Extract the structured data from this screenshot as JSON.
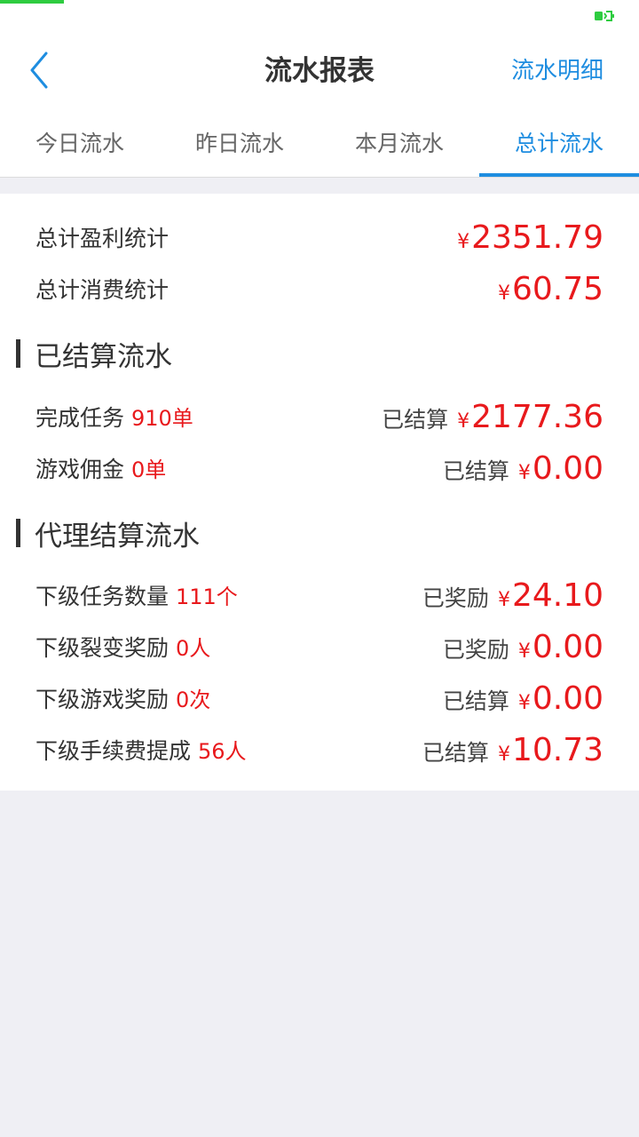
{
  "header": {
    "title": "流水报表",
    "detail_link": "流水明细"
  },
  "colors": {
    "accent": "#1e8de0",
    "amount": "#e8191c",
    "status_progress": "#2ecc40"
  },
  "tabs": [
    {
      "label": "今日流水",
      "active": false
    },
    {
      "label": "昨日流水",
      "active": false
    },
    {
      "label": "本月流水",
      "active": false
    },
    {
      "label": "总计流水",
      "active": true
    }
  ],
  "summary": {
    "profit": {
      "label": "总计盈利统计",
      "currency": "¥",
      "amount": "2351.79"
    },
    "consumption": {
      "label": "总计消费统计",
      "currency": "¥",
      "amount": "60.75"
    }
  },
  "settled": {
    "title": "已结算流水",
    "rows": [
      {
        "label": "完成任务",
        "count": "910单",
        "status": "已结算",
        "currency": "¥",
        "amount": "2177.36"
      },
      {
        "label": "游戏佣金",
        "count": "0单",
        "status": "已结算",
        "currency": "¥",
        "amount": "0.00"
      }
    ]
  },
  "agent": {
    "title": "代理结算流水",
    "rows": [
      {
        "label": "下级任务数量",
        "count": "111个",
        "status": "已奖励",
        "currency": "¥",
        "amount": "24.10"
      },
      {
        "label": "下级裂变奖励",
        "count": "0人",
        "status": "已奖励",
        "currency": "¥",
        "amount": "0.00"
      },
      {
        "label": "下级游戏奖励",
        "count": "0次",
        "status": "已结算",
        "currency": "¥",
        "amount": "0.00"
      },
      {
        "label": "下级手续费提成",
        "count": "56人",
        "status": "已结算",
        "currency": "¥",
        "amount": "10.73"
      }
    ]
  }
}
